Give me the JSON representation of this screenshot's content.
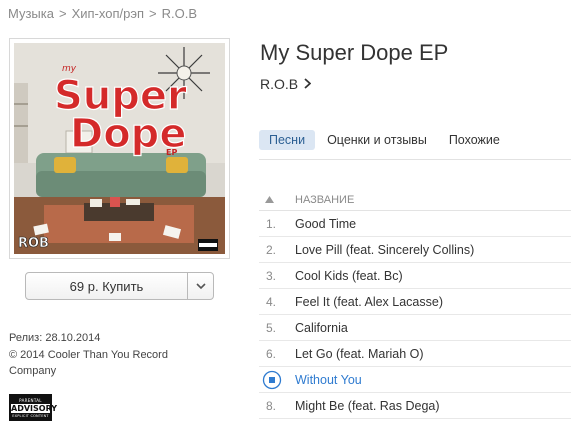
{
  "breadcrumb": {
    "items": [
      "Музыка",
      "Хип-хоп/рэп",
      "R.O.B"
    ],
    "separator": ">"
  },
  "album": {
    "title": "My Super Dope EP",
    "artist": "R.O.B",
    "cover_text": {
      "line1": "Super",
      "line2": "Dope",
      "prefix": "my",
      "suffix": "EP",
      "logo": "ROB"
    }
  },
  "buy": {
    "label": "69 р. Купить",
    "dropdown_icon": "chevron-down-icon"
  },
  "meta": {
    "release": "Релиз: 28.10.2014",
    "copyright": "© 2014 Cooler Than You Record Company"
  },
  "advisory": {
    "line1": "PARENTAL",
    "line2": "ADVISORY",
    "line3": "EXPLICIT CONTENT"
  },
  "tabs": [
    {
      "label": "Песни",
      "active": true
    },
    {
      "label": "Оценки и отзывы",
      "active": false
    },
    {
      "label": "Похожие",
      "active": false
    }
  ],
  "tracklist": {
    "header": "НАЗВАНИЕ",
    "tracks": [
      {
        "num": "1.",
        "title": "Good Time",
        "playing": false
      },
      {
        "num": "2.",
        "title": "Love Pill (feat. Sincerely Collins)",
        "playing": false
      },
      {
        "num": "3.",
        "title": "Cool Kids (feat. Bc)",
        "playing": false
      },
      {
        "num": "4.",
        "title": "Feel It (feat. Alex Lacasse)",
        "playing": false
      },
      {
        "num": "5.",
        "title": "California",
        "playing": false
      },
      {
        "num": "6.",
        "title": "Let Go (feat. Mariah O)",
        "playing": false
      },
      {
        "num": "",
        "title": "Without You",
        "playing": true
      },
      {
        "num": "8.",
        "title": "Might Be (feat. Ras Dega)",
        "playing": false
      }
    ]
  },
  "colors": {
    "accent": "#2f7bd0",
    "tab_active_bg": "#dbe6f3",
    "cover_title_red": "#d42a2a"
  }
}
